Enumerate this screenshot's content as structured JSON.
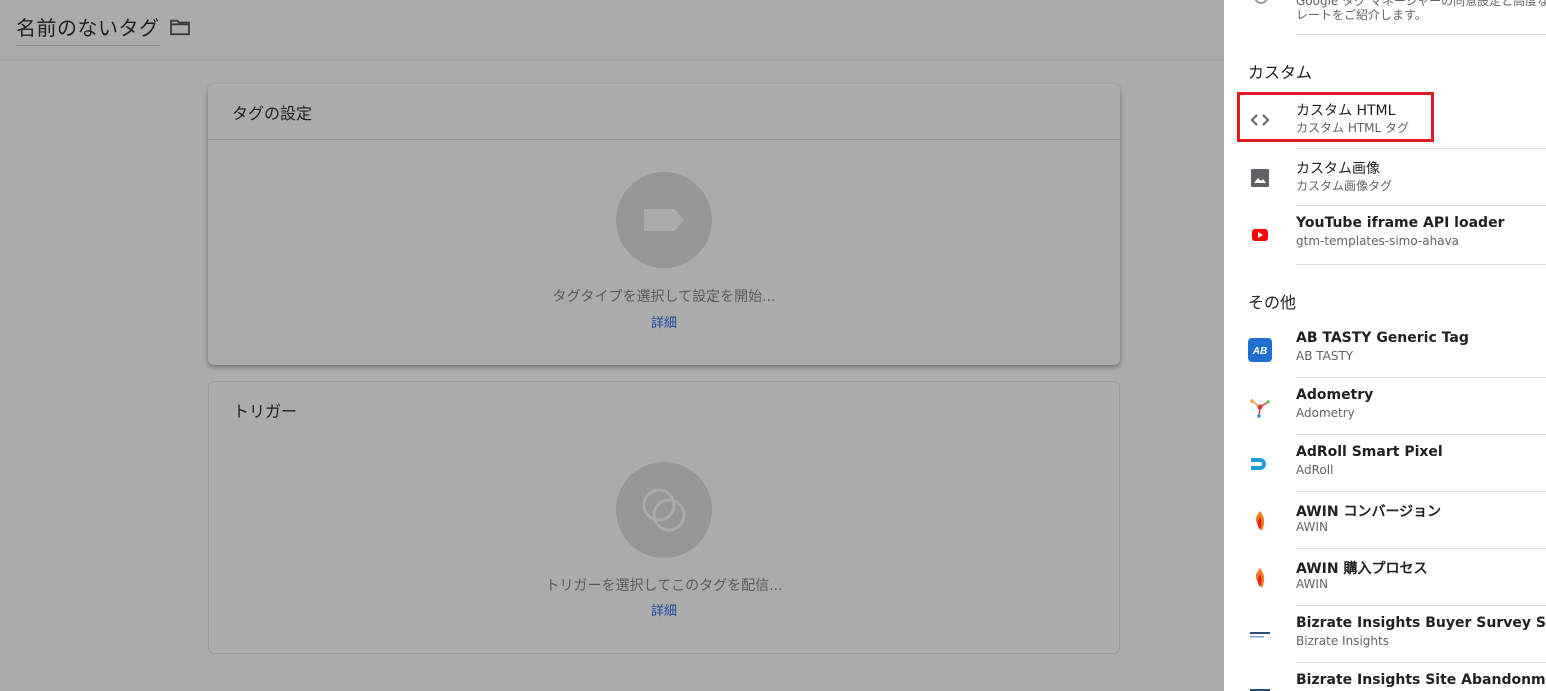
{
  "editor": {
    "tag_name": "名前のないタグ",
    "tag_config": {
      "title": "タグの設定",
      "hint": "タグタイプを選択して設定を開始...",
      "more": "詳細"
    },
    "trigger": {
      "title": "トリガー",
      "hint": "トリガーを選択してこのタグを配信...",
      "more": "詳細"
    }
  },
  "panel": {
    "top_partial_text": "Google タグ マネージャーの同意設定と高度な\nレートをご紹介します。",
    "sections": {
      "custom": "カスタム",
      "other": "その他"
    },
    "custom_items": [
      {
        "title": "カスタム HTML",
        "subtitle": "カスタム HTML タグ",
        "icon": "code-icon"
      },
      {
        "title": "カスタム画像",
        "subtitle": "カスタム画像タグ",
        "icon": "image-icon"
      },
      {
        "title": "YouTube iframe API loader",
        "subtitle": "gtm-templates-simo-ahava",
        "icon": "youtube-icon"
      }
    ],
    "other_items": [
      {
        "title": "AB TASTY Generic Tag",
        "subtitle": "AB TASTY",
        "icon": "abtasty-logo-icon"
      },
      {
        "title": "Adometry",
        "subtitle": "Adometry",
        "icon": "adometry-logo-icon"
      },
      {
        "title": "AdRoll Smart Pixel",
        "subtitle": "AdRoll",
        "icon": "adroll-logo-icon"
      },
      {
        "title": "AWIN コンバージョン",
        "subtitle": "AWIN",
        "icon": "awin-logo-icon"
      },
      {
        "title": "AWIN 購入プロセス",
        "subtitle": "AWIN",
        "icon": "awin-logo-icon"
      },
      {
        "title": "Bizrate Insights Buyer Survey Solution",
        "subtitle": "Bizrate Insights",
        "icon": "bizrate-logo-icon"
      },
      {
        "title": "Bizrate Insights Site Abandonment Sur",
        "subtitle": "",
        "icon": "bizrate-logo-icon"
      }
    ]
  },
  "colors": {
    "overlay_bg": "#ababab",
    "link": "#1c46a4",
    "highlight_box": "#e01b23",
    "youtube_red": "#ff0000",
    "abtasty_blue": "#1f6fd1",
    "adroll_blue": "#1fa0d8"
  }
}
